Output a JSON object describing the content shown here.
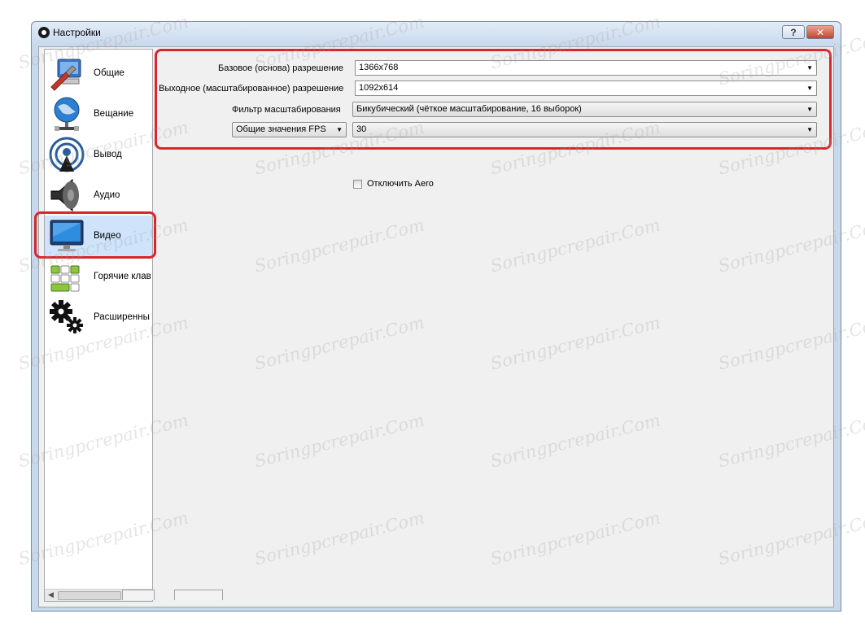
{
  "window": {
    "title": "Настройки",
    "help_label": "?",
    "close_label": "✕"
  },
  "sidebar": {
    "items": [
      {
        "label": "Общие",
        "icon": "general-settings-icon"
      },
      {
        "label": "Вещание",
        "icon": "broadcast-globe-icon"
      },
      {
        "label": "Вывод",
        "icon": "output-signal-icon"
      },
      {
        "label": "Аудио",
        "icon": "speaker-icon"
      },
      {
        "label": "Видео",
        "icon": "monitor-icon",
        "selected": true
      },
      {
        "label": "Горячие клав",
        "icon": "keyboard-icon"
      },
      {
        "label": "Расширенны",
        "icon": "gears-icon"
      }
    ]
  },
  "video": {
    "base_resolution_label": "Базовое (основа) разрешение",
    "base_resolution_value": "1366x768",
    "output_resolution_label": "Выходное (масштабированное) разрешение",
    "output_resolution_value": "1092x614",
    "scale_filter_label": "Фильтр масштабирования",
    "scale_filter_value": "Бикубический (чёткое масштабирование, 16 выборок)",
    "fps_type_value": "Общие значения FPS",
    "fps_value": "30",
    "disable_aero_label": "Отключить Aero"
  },
  "colors": {
    "highlight": "#d8262c",
    "selected_item": "#cfe4fb"
  }
}
